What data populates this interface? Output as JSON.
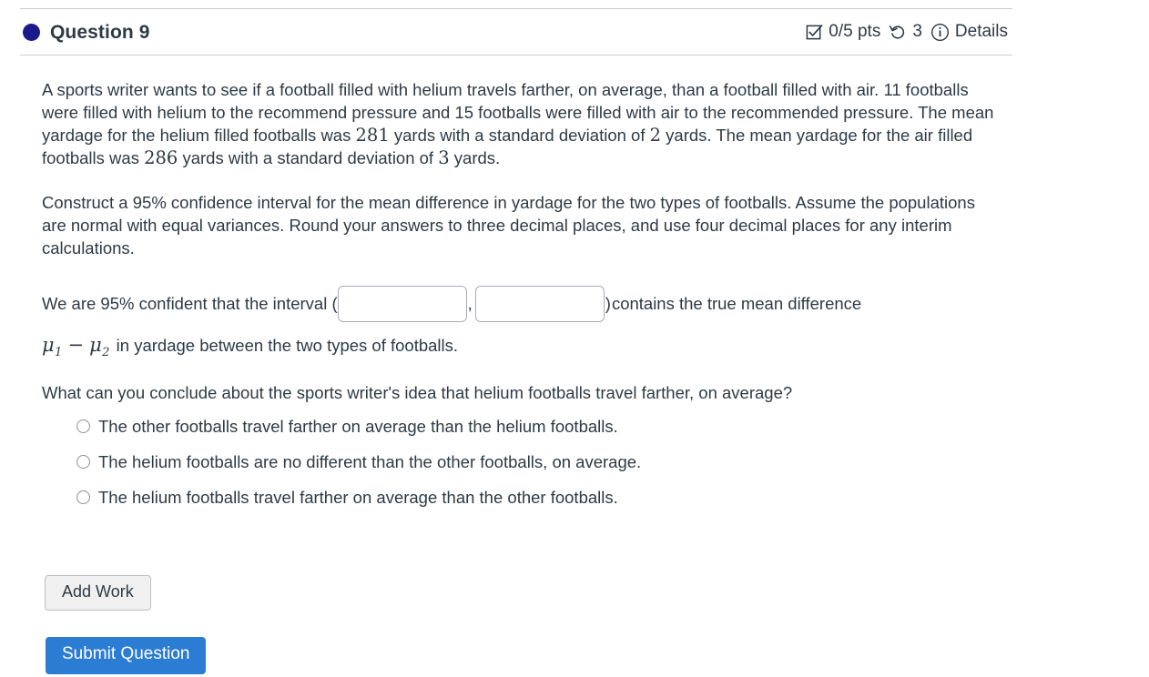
{
  "header": {
    "bullet_color": "#1a1a8c",
    "title": "Question 9",
    "points": "0/5 pts",
    "attempts": "3",
    "details_label": "Details",
    "icons": {
      "points_icon": "checkbox-checked-icon",
      "attempts_icon": "rotate-left-icon",
      "details_icon": "info-circle-icon"
    }
  },
  "question": {
    "paragraph1": {
      "seg1": "A sports writer wants to see if a football filled with helium travels farther, on average, than a football filled with air. 11 footballs were filled with helium to the recommend pressure and 15 footballs were filled with air to the recommended pressure. The mean yardage for the helium filled footballs was ",
      "num1": "281",
      "seg2": " yards with a standard deviation of ",
      "num2": "2",
      "seg3": " yards. The mean yardage for the air filled footballs was ",
      "num3": "286",
      "seg4": " yards with a standard deviation of ",
      "num4": "3",
      "seg5": " yards."
    },
    "paragraph2": "Construct a 95% confidence interval for the mean difference in yardage for the two types of footballs. Assume the populations are normal with equal variances. Round your answers to three decimal places, and use four decimal places for any interim calculations."
  },
  "answer": {
    "prefix": "We are 95% confident that the interval (",
    "comma": ",",
    "close_paren": ")",
    "suffix": " contains the true mean difference",
    "mu_symbol": "μ",
    "mu1_sub": "1",
    "minus": "−",
    "mu2_sub": "2",
    "tail": "in yardage between the two types of footballs.",
    "input_lower": {
      "value": "",
      "placeholder": ""
    },
    "input_upper": {
      "value": "",
      "placeholder": ""
    }
  },
  "conclusion": {
    "prompt": "What can you conclude about the sports writer's idea that helium footballs travel farther, on average?",
    "options": [
      {
        "label": "The other footballs travel farther on average than the helium footballs.",
        "selected": false
      },
      {
        "label": "The helium footballs are no different than the other footballs, on average.",
        "selected": false
      },
      {
        "label": "The helium footballs travel farther on average than the other footballs.",
        "selected": false
      }
    ]
  },
  "actions": {
    "add_work_label": "Add Work",
    "submit_label": "Submit Question",
    "submit_color": "#2b7cd3"
  }
}
